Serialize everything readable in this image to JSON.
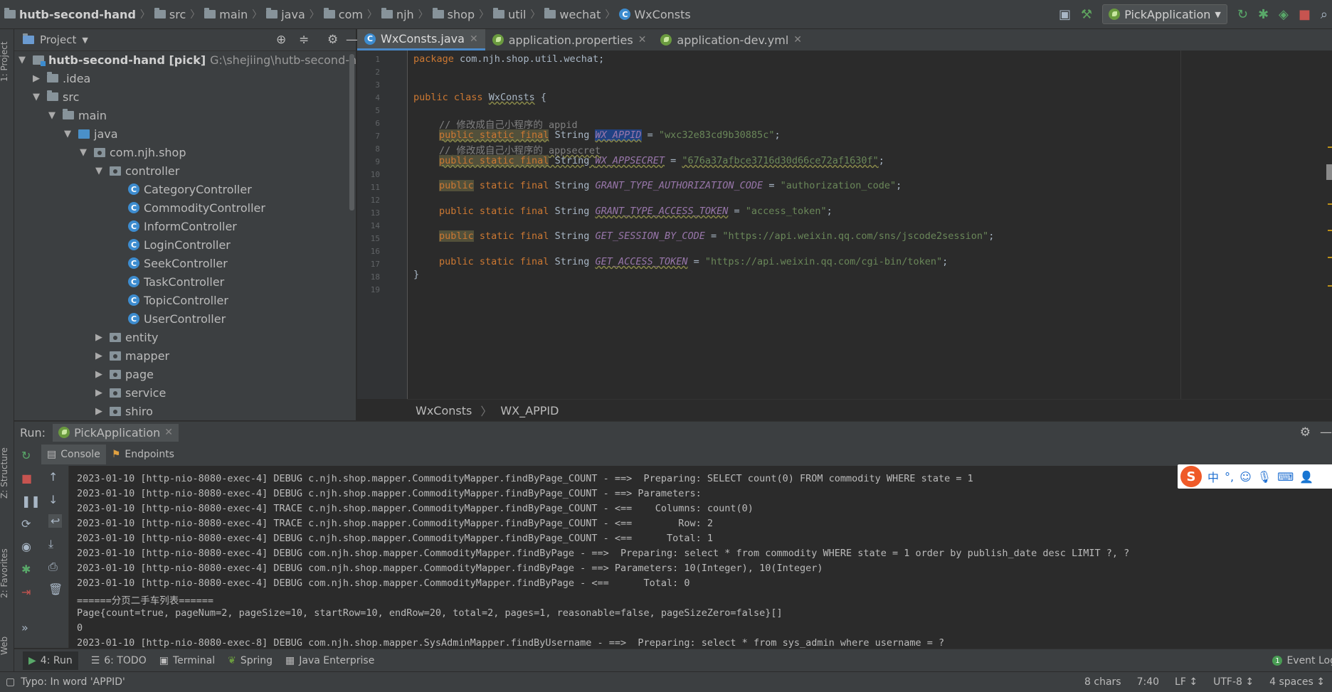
{
  "navbar": {
    "crumbs": [
      "hutb-second-hand",
      "src",
      "main",
      "java",
      "com",
      "njh",
      "shop",
      "util",
      "wechat",
      "WxConsts"
    ],
    "run_config": "PickApplication"
  },
  "left_stripe": {
    "project": "1: Project",
    "structure": "Z: Structure",
    "favorites": "2: Favorites",
    "web": "Web"
  },
  "project_panel": {
    "title": "Project",
    "root_name": "hutb-second-hand [pick]",
    "root_path": "G:\\shejiing\\hutb-second-hand",
    "folders": {
      "idea": ".idea",
      "src": "src",
      "main": "main",
      "java": "java",
      "package": "com.njh.shop",
      "controller": "controller",
      "entity": "entity",
      "mapper": "mapper",
      "page": "page",
      "service": "service",
      "shiro": "shiro"
    },
    "controllers": [
      "CategoryController",
      "CommodityController",
      "InformController",
      "LoginController",
      "SeekController",
      "TaskController",
      "TopicController",
      "UserController"
    ]
  },
  "editor": {
    "tabs": [
      "WxConsts.java",
      "application.properties",
      "application-dev.yml"
    ],
    "line_numbers": [
      "1",
      "2",
      "3",
      "4",
      "5",
      "6",
      "7",
      "8",
      "9",
      "10",
      "11",
      "12",
      "13",
      "14",
      "15",
      "16",
      "17",
      "18",
      "19"
    ],
    "code": {
      "l1_kw": "package",
      "l1_rest": " com.njh.shop.util.wechat;",
      "l4_kw": "public class",
      "l4_name": "WxConsts",
      "l4_rest": " {",
      "comment1": "// 修改成自己小程序的 appid",
      "kw_psf": "public static final",
      "kw_public": "public",
      "kw_static_final": " static final",
      "type_string": " String ",
      "f_appid": "WX_APPID",
      "v_appid": "\"wxc32e83cd9b30885c\"",
      "comment2": "// 修改成自己小程序的 appsecret",
      "f_secret": "WX_APPSECRET",
      "v_secret": "\"676a37afbce3716d30d66ce72af1630f\"",
      "f_auth": "GRANT_TYPE_AUTHORIZATION_CODE",
      "v_auth": "\"authorization_code\"",
      "f_token_type": "GRANT_TYPE_ACCESS_TOKEN",
      "v_token_type": "\"access_token\"",
      "f_session": "GET_SESSION_BY_CODE",
      "v_session": "\"https://api.weixin.qq.com/sns/jscode2session\"",
      "f_access": "GET_ACCESS_TOKEN",
      "v_access": "\"https://api.weixin.qq.com/cgi-bin/token\"",
      "eq": " = ",
      "semi": ";",
      "close": "}"
    },
    "breadcrumb": [
      "WxConsts",
      "WX_APPID"
    ]
  },
  "run_panel": {
    "label": "Run:",
    "app_tab": "PickApplication",
    "tabs": [
      "Console",
      "Endpoints"
    ],
    "log_lines": [
      "2023-01-10 [http-nio-8080-exec-4] DEBUG c.njh.shop.mapper.CommodityMapper.findByPage_COUNT - ==>  Preparing: SELECT count(0) FROM commodity WHERE state = 1",
      "2023-01-10 [http-nio-8080-exec-4] DEBUG c.njh.shop.mapper.CommodityMapper.findByPage_COUNT - ==> Parameters: ",
      "2023-01-10 [http-nio-8080-exec-4] TRACE c.njh.shop.mapper.CommodityMapper.findByPage_COUNT - <==    Columns: count(0)",
      "2023-01-10 [http-nio-8080-exec-4] TRACE c.njh.shop.mapper.CommodityMapper.findByPage_COUNT - <==        Row: 2",
      "2023-01-10 [http-nio-8080-exec-4] DEBUG c.njh.shop.mapper.CommodityMapper.findByPage_COUNT - <==      Total: 1",
      "2023-01-10 [http-nio-8080-exec-4] DEBUG com.njh.shop.mapper.CommodityMapper.findByPage - ==>  Preparing: select * from commodity WHERE state = 1 order by publish_date desc LIMIT ?, ?",
      "2023-01-10 [http-nio-8080-exec-4] DEBUG com.njh.shop.mapper.CommodityMapper.findByPage - ==> Parameters: 10(Integer), 10(Integer)",
      "2023-01-10 [http-nio-8080-exec-4] DEBUG com.njh.shop.mapper.CommodityMapper.findByPage - <==      Total: 0",
      "======分页二手车列表======",
      "Page{count=true, pageNum=2, pageSize=10, startRow=10, endRow=20, total=2, pages=1, reasonable=false, pageSizeZero=false}[]",
      "0",
      "2023-01-10 [http-nio-8080-exec-8] DEBUG com.njh.shop.mapper.SysAdminMapper.findByUsername - ==>  Preparing: select * from sys_admin where username = ?"
    ]
  },
  "ime": {
    "lang": "中",
    "punct": "°,"
  },
  "tool_tabs": [
    "4: Run",
    "6: TODO",
    "Terminal",
    "Spring",
    "Java Enterprise"
  ],
  "event_log": {
    "count": "1",
    "label": "Event Log"
  },
  "status_bar": {
    "message": "Typo: In word 'APPID'",
    "chars": "8 chars",
    "position": "7:40",
    "line_sep": "LF ↕",
    "encoding": "UTF-8 ↕",
    "indent": "4 spaces ↕"
  },
  "colors": {
    "keyword": "#cc7832",
    "string": "#6a8759",
    "field": "#9876aa",
    "comment": "#808080",
    "accent": "#4a88c7"
  }
}
